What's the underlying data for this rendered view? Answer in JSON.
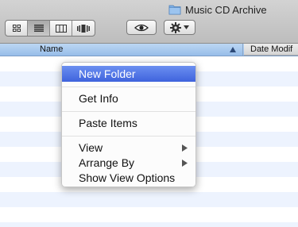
{
  "window": {
    "title": "Music CD Archive",
    "folder_icon": "folder-icon"
  },
  "toolbar": {
    "view_buttons": [
      {
        "name": "icon-view",
        "icon": "icon-view-icon",
        "active": false
      },
      {
        "name": "list-view",
        "icon": "list-view-icon",
        "active": true
      },
      {
        "name": "column-view",
        "icon": "column-view-icon",
        "active": false
      },
      {
        "name": "cover-flow-view",
        "icon": "cover-flow-icon",
        "active": false
      }
    ],
    "quicklook_icon": "eye-icon",
    "action_icon": "gear-icon"
  },
  "columns": {
    "name_label": "Name",
    "date_label": "Date Modif",
    "sort": "ascending"
  },
  "context_menu": {
    "items": [
      {
        "label": "New Folder",
        "highlighted": true
      },
      {
        "label": "Get Info"
      },
      {
        "label": "Paste Items"
      },
      {
        "label": "View",
        "has_submenu": true
      },
      {
        "label": "Arrange By",
        "has_submenu": true
      },
      {
        "label": "Show View Options"
      }
    ]
  },
  "colors": {
    "highlight": "#3f63dd",
    "header_blue": "#a9c9ef",
    "row_stripe": "#edf3fe"
  }
}
